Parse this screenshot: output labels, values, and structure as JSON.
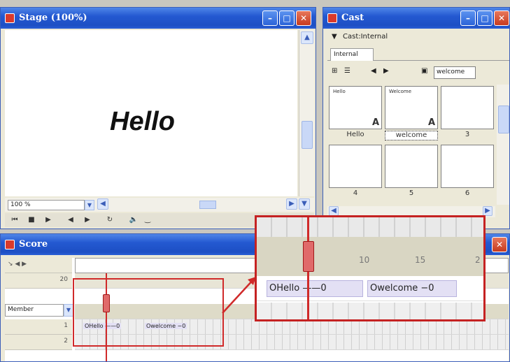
{
  "stage": {
    "title": "Stage (100%)",
    "canvas_text": "Hello",
    "zoom_value": "100 %"
  },
  "cast": {
    "title": "Cast",
    "cast_selector": "Cast:Internal",
    "tab_label": "Internal",
    "name_field": "welcome",
    "members": [
      {
        "thumb_name": "Hello",
        "label": "Hello",
        "glyph": "A",
        "selected": false
      },
      {
        "thumb_name": "Welcome",
        "label": "welcome",
        "glyph": "A",
        "selected": true
      },
      {
        "thumb_name": "",
        "label": "3",
        "glyph": "",
        "selected": false
      },
      {
        "thumb_name": "",
        "label": "4",
        "glyph": "",
        "selected": false
      },
      {
        "thumb_name": "",
        "label": "5",
        "glyph": "",
        "selected": false
      },
      {
        "thumb_name": "",
        "label": "6",
        "glyph": "",
        "selected": false
      }
    ]
  },
  "score": {
    "title": "Score",
    "member_select": "Member",
    "row_numbers": [
      "1",
      "2"
    ],
    "frame_number_header": "20",
    "sprite_hello": "OHello ——0",
    "sprite_welcome": "Owelcome −0"
  },
  "zoom_callout": {
    "frame_numbers": [
      "10",
      "15",
      "2"
    ],
    "sprite_hello": "OHello ——0",
    "sprite_welcome": "Owelcome −0"
  },
  "colors": {
    "titlebar": "#2459d1",
    "highlight_box": "#d02a2a",
    "sprite_fill": "#e3e0f4"
  }
}
